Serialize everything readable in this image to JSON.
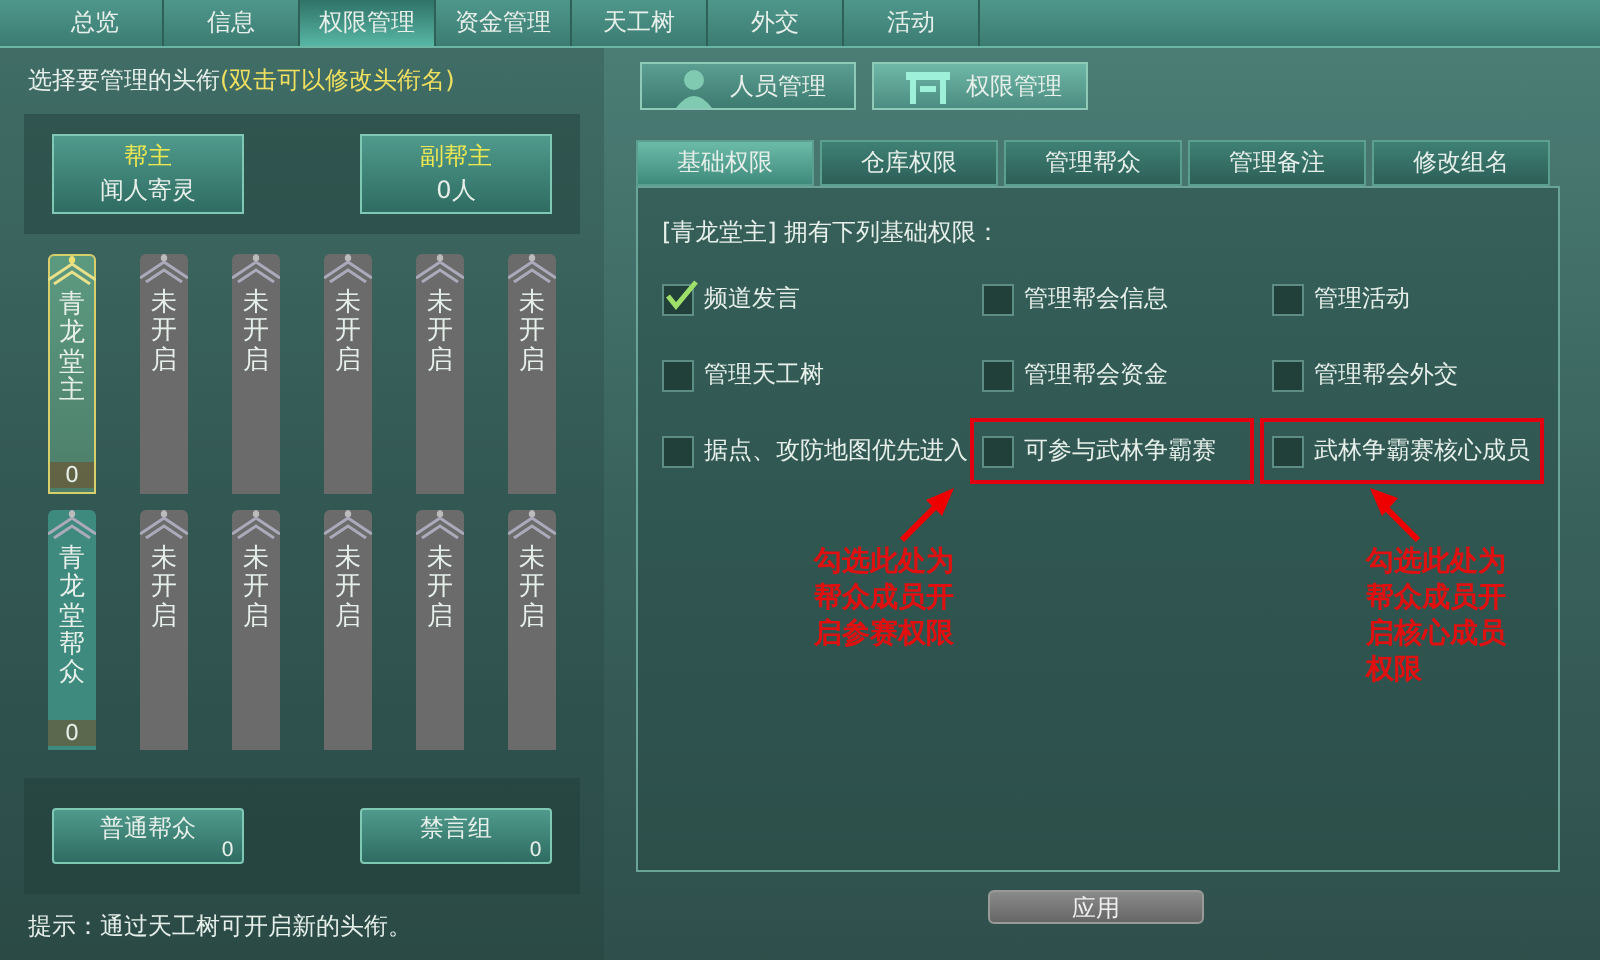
{
  "top_tabs": [
    {
      "label": "总览",
      "selected": false
    },
    {
      "label": "信息",
      "selected": false
    },
    {
      "label": "权限管理",
      "selected": true
    },
    {
      "label": "资金管理",
      "selected": false
    },
    {
      "label": "天工树",
      "selected": false
    },
    {
      "label": "外交",
      "selected": false
    },
    {
      "label": "活动",
      "selected": false
    }
  ],
  "left": {
    "prompt": "选择要管理的头衔",
    "prompt_hint": "(双击可以修改头衔名)",
    "leaders": [
      {
        "title": "帮主",
        "value": "闻人寄灵"
      },
      {
        "title": "副帮主",
        "value": "0人"
      }
    ],
    "ranks": [
      {
        "label": "青龙堂主",
        "kind": "open",
        "selected": true,
        "count": "0"
      },
      {
        "label": "未开启",
        "kind": "locked",
        "selected": false
      },
      {
        "label": "未开启",
        "kind": "locked",
        "selected": false
      },
      {
        "label": "未开启",
        "kind": "locked",
        "selected": false
      },
      {
        "label": "未开启",
        "kind": "locked",
        "selected": false
      },
      {
        "label": "未开启",
        "kind": "locked",
        "selected": false
      },
      {
        "label": "青龙堂帮众",
        "kind": "open",
        "selected": false,
        "count": "0"
      },
      {
        "label": "未开启",
        "kind": "locked",
        "selected": false
      },
      {
        "label": "未开启",
        "kind": "locked",
        "selected": false
      },
      {
        "label": "未开启",
        "kind": "locked",
        "selected": false
      },
      {
        "label": "未开启",
        "kind": "locked",
        "selected": false
      },
      {
        "label": "未开启",
        "kind": "locked",
        "selected": false
      }
    ],
    "groups": [
      {
        "label": "普通帮众",
        "count": "0"
      },
      {
        "label": "禁言组",
        "count": "0"
      }
    ],
    "tip": "提示：通过天工树可开启新的头衔。"
  },
  "mode_buttons": [
    {
      "label": "人员管理",
      "selected": false,
      "kind": "person"
    },
    {
      "label": "权限管理",
      "selected": true,
      "kind": "gate"
    }
  ],
  "sub_tabs": [
    {
      "label": "基础权限",
      "selected": true
    },
    {
      "label": "仓库权限",
      "selected": false
    },
    {
      "label": "管理帮众",
      "selected": false
    },
    {
      "label": "管理备注",
      "selected": false
    },
    {
      "label": "修改组名",
      "selected": false
    }
  ],
  "permissions_heading": "[青龙堂主] 拥有下列基础权限：",
  "permissions": [
    {
      "label": "频道发言",
      "checked": true,
      "highlighted": false
    },
    {
      "label": "管理帮会信息",
      "checked": false,
      "highlighted": false
    },
    {
      "label": "管理活动",
      "checked": false,
      "highlighted": false
    },
    {
      "label": "管理天工树",
      "checked": false,
      "highlighted": false
    },
    {
      "label": "管理帮会资金",
      "checked": false,
      "highlighted": false
    },
    {
      "label": "管理帮会外交",
      "checked": false,
      "highlighted": false
    },
    {
      "label": "据点、攻防地图优先进入",
      "checked": false,
      "highlighted": false
    },
    {
      "label": "可参与武林争霸赛",
      "checked": false,
      "highlighted": true
    },
    {
      "label": "武林争霸赛核心成员",
      "checked": false,
      "highlighted": true
    }
  ],
  "annotations": [
    {
      "text": "勾选此处为帮众成员开启参赛权限"
    },
    {
      "text": "勾选此处为帮众成员开启核心成员权限"
    }
  ],
  "apply_button": "应用"
}
